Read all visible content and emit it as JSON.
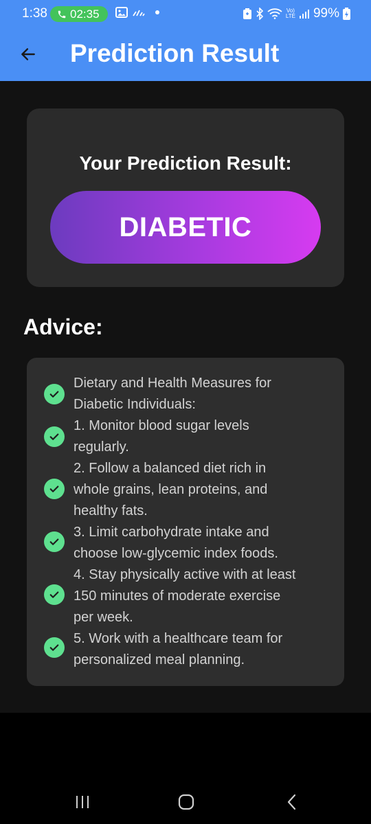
{
  "status_bar": {
    "time": "1:38",
    "call_timer": "02:35",
    "battery": "99%",
    "network_top": "Vo)",
    "network_bottom": "LTE"
  },
  "app_bar": {
    "title": "Prediction Result",
    "color": "#4a8ff5"
  },
  "result": {
    "heading": "Your Prediction Result:",
    "value": "DIABETIC",
    "gradient": [
      "#6c3bbf",
      "#d63bf0"
    ]
  },
  "advice": {
    "title": "Advice:",
    "lines": [
      "Dietary and Health Measures for",
      "Diabetic Individuals:",
      "1. Monitor blood sugar levels",
      "regularly.",
      "2. Follow a balanced diet rich in",
      "whole grains, lean proteins, and",
      "healthy fats.",
      "3. Limit carbohydrate intake and",
      "choose low-glycemic index foods.",
      "4. Stay physically active with at least",
      "150 minutes of moderate exercise",
      "per week.",
      "5. Work with a healthcare team for",
      "personalized meal planning."
    ],
    "check_color": "#5ee08f"
  },
  "nav_bar": {
    "recents_icon": "recents-icon",
    "home_icon": "home-icon",
    "back_icon": "back-icon"
  }
}
